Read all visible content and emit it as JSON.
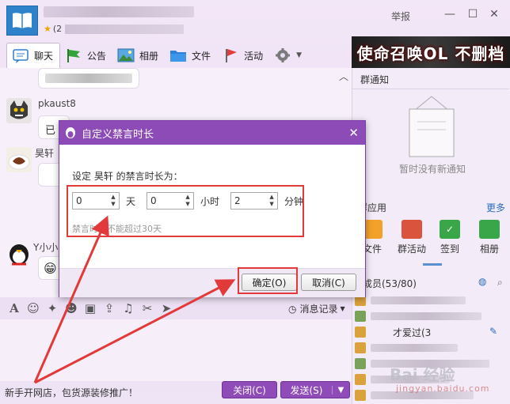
{
  "window": {
    "group_sub_prefix": "(2",
    "report_label": "举报",
    "controls": {
      "minimize": "—",
      "maximize": "☐",
      "close": "✕"
    }
  },
  "toolbar": {
    "items": [
      {
        "label": "聊天",
        "icon": "chat-icon"
      },
      {
        "label": "公告",
        "icon": "flag-icon"
      },
      {
        "label": "相册",
        "icon": "picture-icon"
      },
      {
        "label": "文件",
        "icon": "folder-icon"
      },
      {
        "label": "活动",
        "icon": "pin-flag-icon"
      },
      {
        "label": "",
        "icon": "gear-icon"
      }
    ]
  },
  "banner": {
    "text": "使命召唤OL 不删档"
  },
  "chat": {
    "messages": [
      {
        "sender": "pkaust8",
        "text_prefix": "已"
      },
      {
        "sender": "昊轩"
      },
      {
        "sender": "Y小小"
      }
    ]
  },
  "input_toolbar": {
    "history_label": "消息记录"
  },
  "footer": {
    "promo": "新手开网店，包货源装修推广！",
    "close_label": "关闭(C)",
    "send_label": "发送(S)"
  },
  "right_panel": {
    "notice_title": "群通知",
    "notice_empty": "暂时没有新通知",
    "apps_title": "群应用",
    "more_label": "更多",
    "apps": [
      {
        "label": "文件",
        "color": "#f2a22a"
      },
      {
        "label": "群活动",
        "color": "#d9533d"
      },
      {
        "label": "签到",
        "color": "#3aa64a"
      },
      {
        "label": "相册",
        "color": "#3aa64a"
      }
    ],
    "members_title": "成员(53/80)",
    "member_visible_text": "才爱过(3"
  },
  "dialog": {
    "title": "自定义禁言时长",
    "close": "✕",
    "prompt": "设定 昊轩 的禁言时长为：",
    "days_value": "0",
    "days_unit": "天",
    "hours_value": "0",
    "hours_unit": "小时",
    "minutes_value": "2",
    "minutes_unit": "分钟",
    "hint": "禁言时长不能超过30天",
    "ok_label": "确定(O)",
    "cancel_label": "取消(C)"
  },
  "watermark": {
    "text": "Bai 经验",
    "sub": "jingyan.baidu.com"
  },
  "colors": {
    "accent": "#8c4bb6",
    "annotation": "#e23a3a"
  }
}
